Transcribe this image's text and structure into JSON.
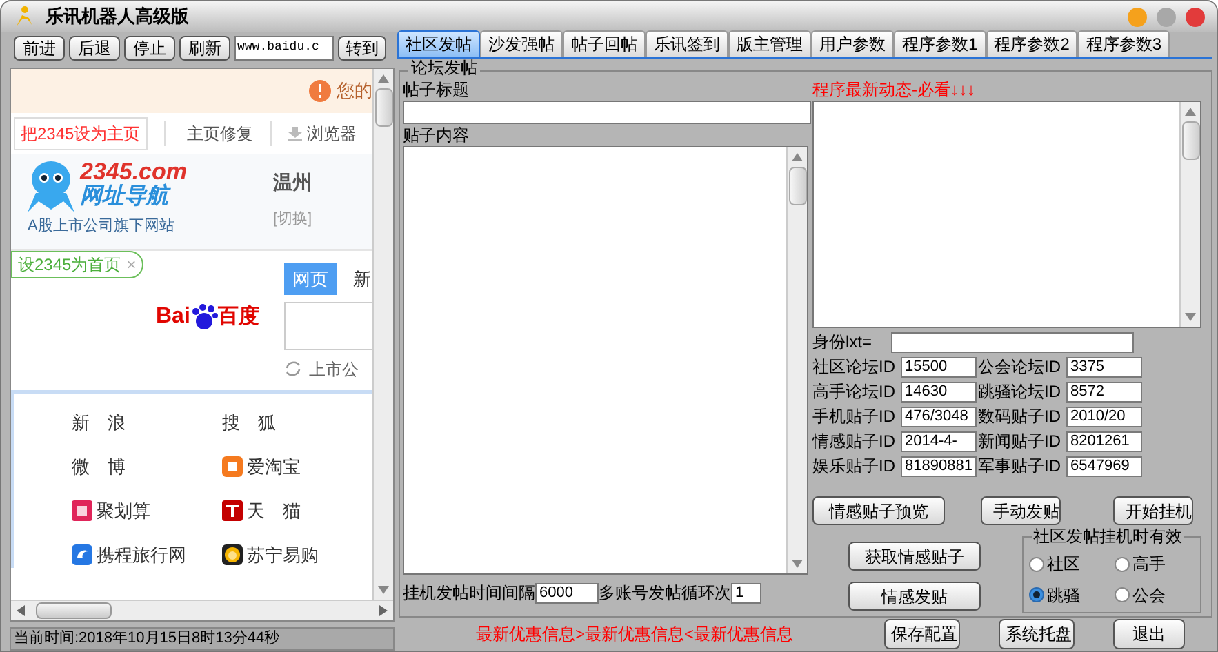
{
  "window": {
    "title": "乐讯机器人高级版"
  },
  "browser": {
    "nav_buttons": [
      "前进",
      "后退",
      "停止",
      "刷新"
    ],
    "url": "www.baidu.c",
    "go_button": "转到",
    "page": {
      "notice": "您的",
      "toplinks": [
        {
          "kind": "primary",
          "label": "把2345设为主页"
        },
        {
          "kind": "plain",
          "label": "主页修复"
        },
        {
          "kind": "download",
          "label": "浏览器"
        }
      ],
      "logo": {
        "brand": "2345.com",
        "name": "网址导航",
        "slogan": "A股上市公司旗下网站"
      },
      "city": "温州",
      "city_switch": "[切换]",
      "set_home_tag": "设2345为首页",
      "tag_close": "×",
      "search_tabs": [
        {
          "label": "网页",
          "selected": true
        },
        {
          "label": "新",
          "selected": false
        }
      ],
      "baidu": {
        "latin": "Bai",
        "chinese": "百度"
      },
      "hint": "上市公",
      "sites": [
        {
          "label": "新　浪",
          "kind": "plain"
        },
        {
          "label": "搜　狐",
          "kind": "plain"
        },
        {
          "label": "微　博",
          "kind": "plain"
        },
        {
          "label": "爱淘宝",
          "kind": "taobao"
        },
        {
          "label": "聚划算",
          "kind": "ju"
        },
        {
          "label": "天　猫",
          "kind": "tmall"
        },
        {
          "label": "携程旅行网",
          "kind": "ctrip"
        },
        {
          "label": "苏宁易购",
          "kind": "suning"
        }
      ]
    },
    "status": "当前时间:2018年10月15日8时13分44秒"
  },
  "tabs": [
    {
      "label": "社区发帖",
      "selected": true
    },
    {
      "label": "沙发强帖",
      "selected": false
    },
    {
      "label": "帖子回帖",
      "selected": false
    },
    {
      "label": "乐讯签到",
      "selected": false
    },
    {
      "label": "版主管理",
      "selected": false
    },
    {
      "label": "用户参数",
      "selected": false
    },
    {
      "label": "程序参数1",
      "selected": false
    },
    {
      "label": "程序参数2",
      "selected": false
    },
    {
      "label": "程序参数3",
      "selected": false
    }
  ],
  "forum": {
    "group_title": "论坛发帖",
    "title_label": "帖子标题",
    "content_label": "贴子内容",
    "news_label": "程序最新动态-必看↓↓↓",
    "identity_label": "身份lxt=",
    "ids": [
      [
        {
          "label": "社区论坛ID",
          "value": "15500"
        },
        {
          "label": "公会论坛ID",
          "value": "3375"
        }
      ],
      [
        {
          "label": "高手论坛ID",
          "value": "14630"
        },
        {
          "label": "跳骚论坛ID",
          "value": "8572"
        }
      ],
      [
        {
          "label": "手机贴子ID",
          "value": "476/3048"
        },
        {
          "label": "数码贴子ID",
          "value": "2010/20"
        }
      ],
      [
        {
          "label": "情感贴子ID",
          "value": "2014-4-"
        },
        {
          "label": "新闻贴子ID",
          "value": "8201261"
        }
      ],
      [
        {
          "label": "娱乐贴子ID",
          "value": "81890881"
        },
        {
          "label": "军事贴子ID",
          "value": "6547969"
        }
      ]
    ],
    "row_buttons": [
      "情感贴子预览",
      "手动发贴",
      "开始挂机"
    ],
    "left_buttons": [
      "获取情感贴子",
      "情感发贴"
    ],
    "radio_group": {
      "title": "社区发帖挂机时有效",
      "options": [
        {
          "label": "社区",
          "selected": false
        },
        {
          "label": "高手",
          "selected": false
        },
        {
          "label": "跳骚",
          "selected": true
        },
        {
          "label": "公会",
          "selected": false
        }
      ]
    },
    "interval_label": "挂机发帖时间间隔",
    "interval_value": "6000",
    "loop_label": "多账号发帖循环次",
    "loop_value": "1"
  },
  "footer": {
    "marquee": "最新优惠信息>最新优惠信息<最新优惠信息",
    "buttons": [
      "保存配置",
      "系统托盘",
      "退出"
    ]
  }
}
